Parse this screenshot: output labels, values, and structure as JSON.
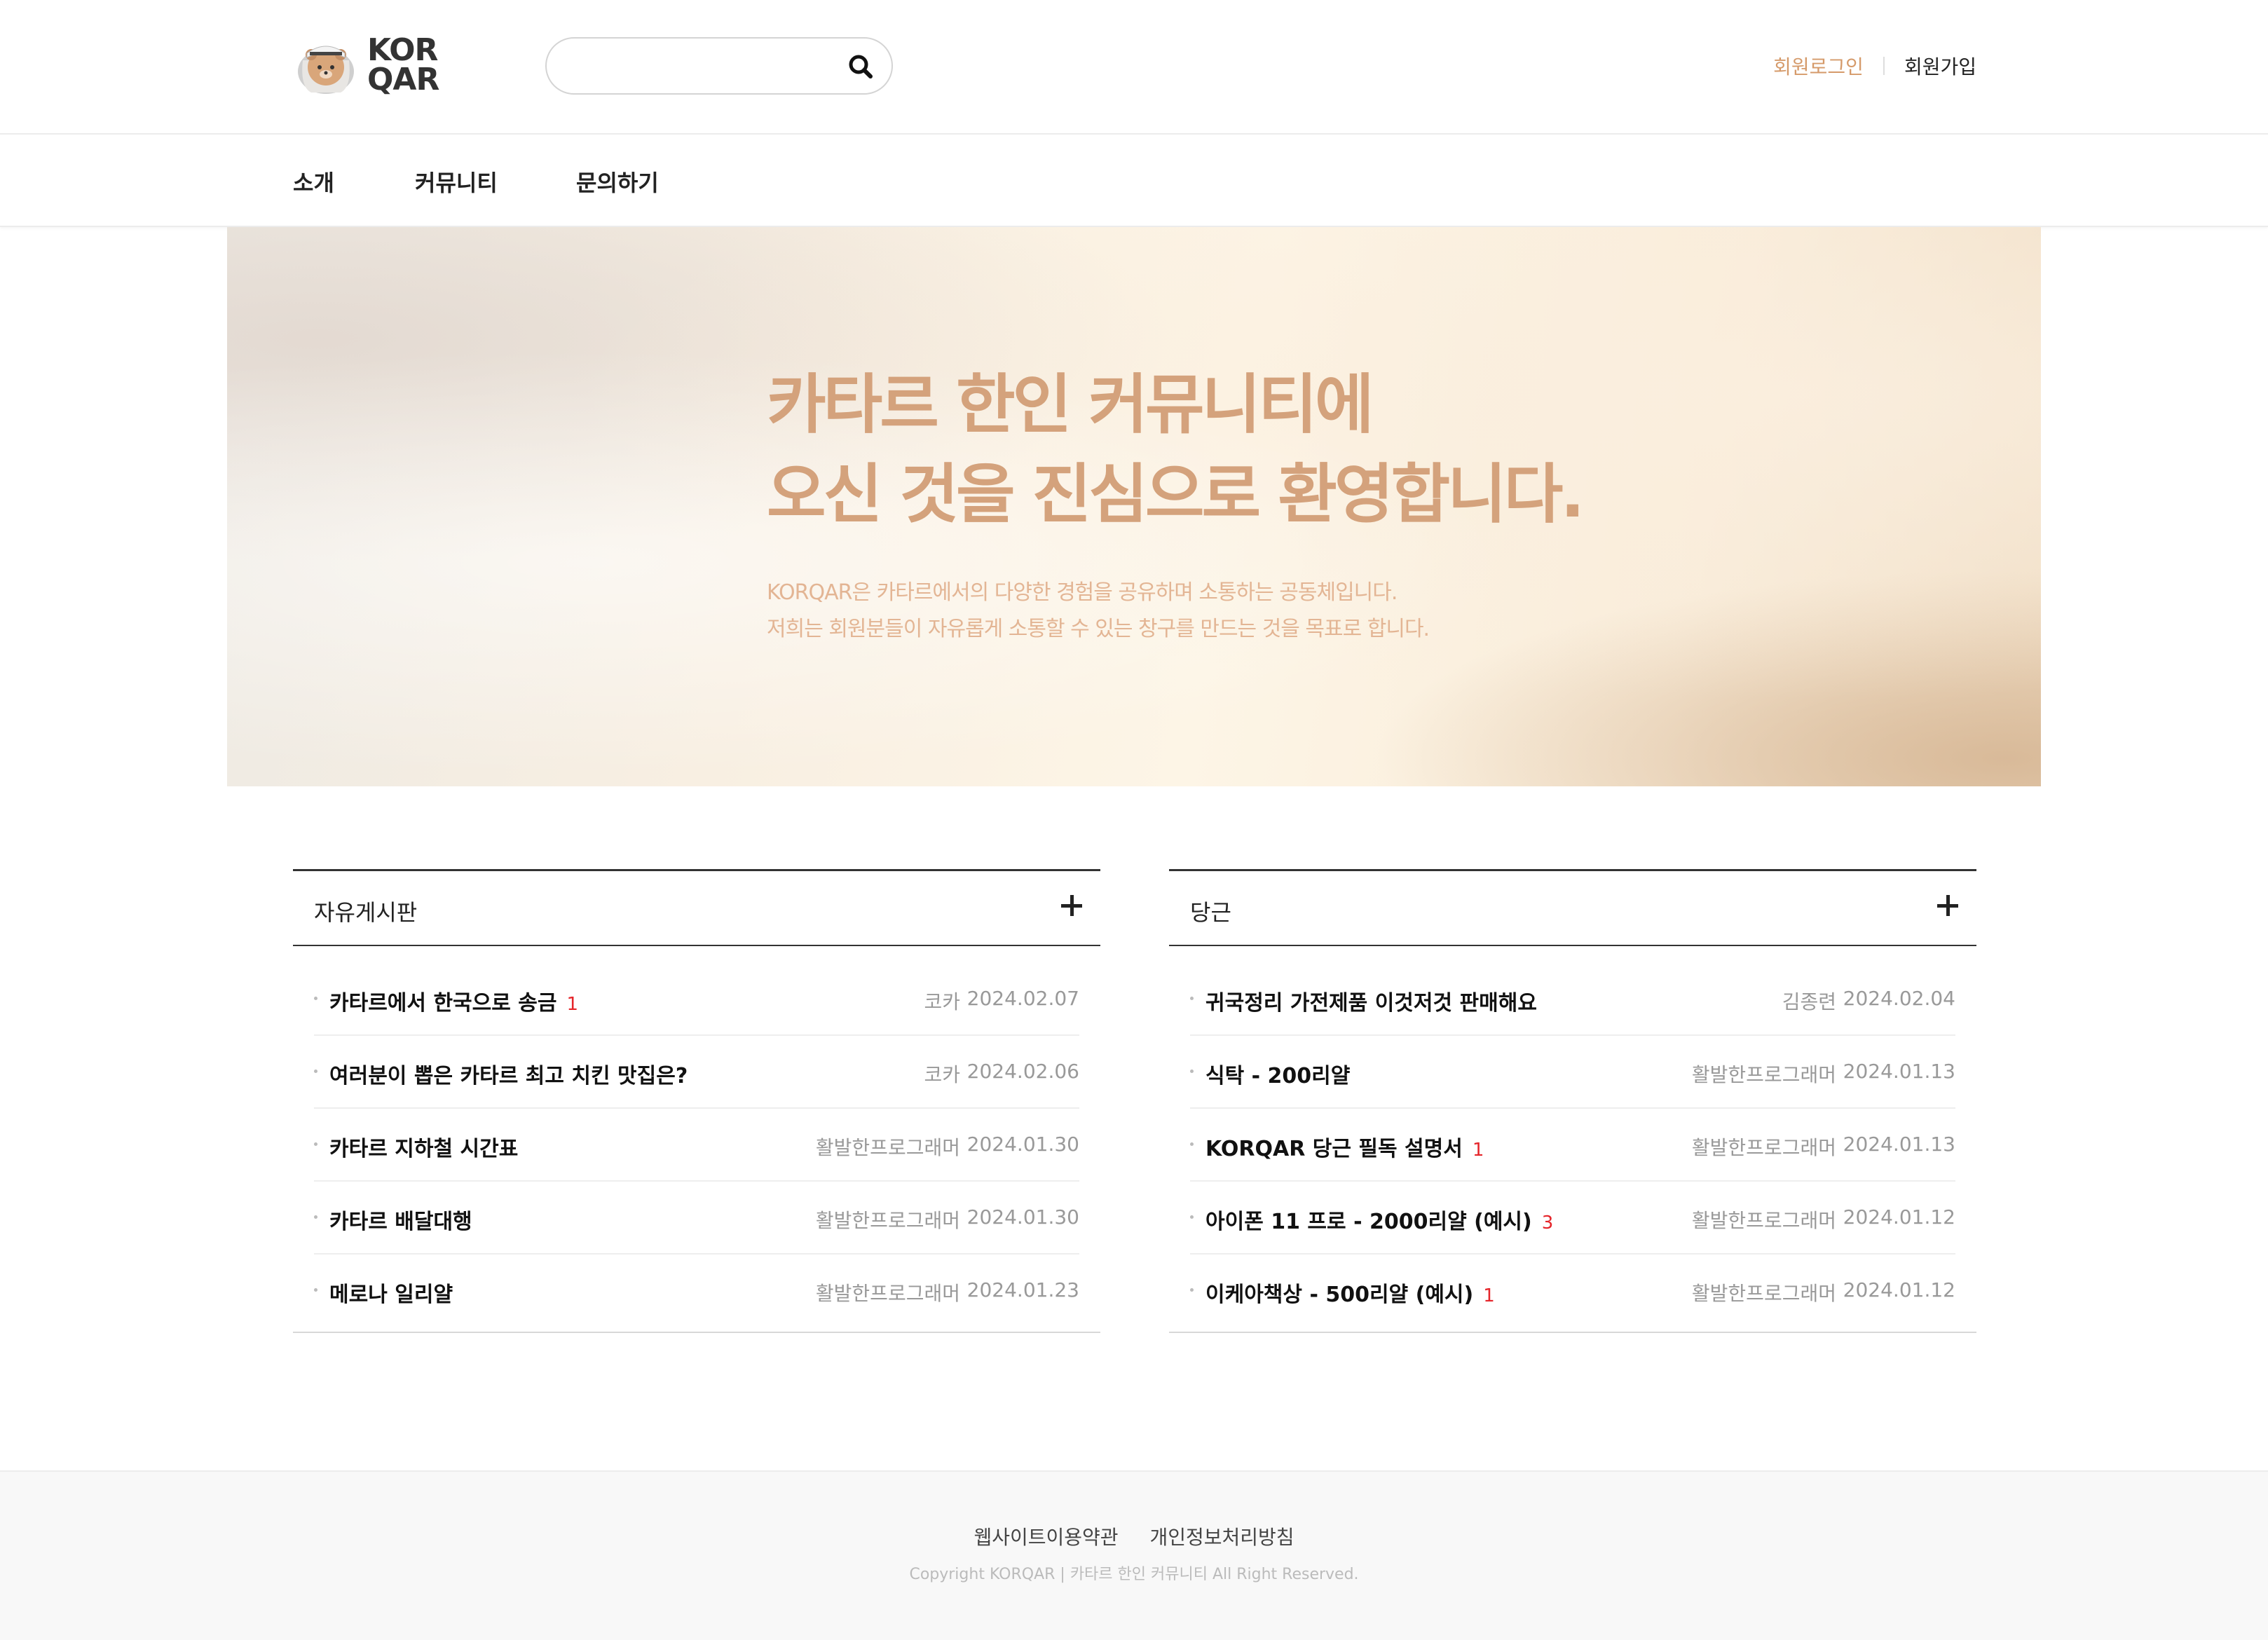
{
  "header": {
    "logo_text_line1": "KOR",
    "logo_text_line2": "QAR",
    "search_placeholder": "",
    "login_label": "회원로그인",
    "join_label": "회원가입"
  },
  "nav": [
    "소개",
    "커뮤니티",
    "문의하기"
  ],
  "hero": {
    "title_line1": "카타르 한인 커뮤니티에",
    "title_line2": "오신 것을 진심으로 환영합니다.",
    "desc_line1": "KORQAR은 카타르에서의 다양한 경험을 공유하며 소통하는 공동체입니다.",
    "desc_line2": "저희는 회원분들이 자유롭게 소통할 수 있는 창구를 만드는 것을 목표로 합니다."
  },
  "boards": [
    {
      "title": "자유게시판",
      "posts": [
        {
          "subject": "카타르에서 한국으로 송금",
          "comments": "1",
          "author": "코카",
          "date": "2024.02.07"
        },
        {
          "subject": "여러분이 뽑은 카타르 최고 치킨 맛집은?",
          "comments": "",
          "author": "코카",
          "date": "2024.02.06"
        },
        {
          "subject": "카타르 지하철 시간표",
          "comments": "",
          "author": "활발한프로그래머",
          "date": "2024.01.30"
        },
        {
          "subject": "카타르 배달대행",
          "comments": "",
          "author": "활발한프로그래머",
          "date": "2024.01.30"
        },
        {
          "subject": "메로나 일리얄",
          "comments": "",
          "author": "활발한프로그래머",
          "date": "2024.01.23"
        }
      ]
    },
    {
      "title": "당근",
      "posts": [
        {
          "subject": "귀국정리 가전제품 이것저것 판매해요",
          "comments": "",
          "author": "김종련",
          "date": "2024.02.04"
        },
        {
          "subject": "식탁 - 200리얄",
          "comments": "",
          "author": "활발한프로그래머",
          "date": "2024.01.13"
        },
        {
          "subject": "KORQAR 당근 필독 설명서",
          "comments": "1",
          "author": "활발한프로그래머",
          "date": "2024.01.13"
        },
        {
          "subject": "아이폰 11 프로 - 2000리얄 (예시)",
          "comments": "3",
          "author": "활발한프로그래머",
          "date": "2024.01.12"
        },
        {
          "subject": "이케아책상 - 500리얄 (예시)",
          "comments": "1",
          "author": "활발한프로그래머",
          "date": "2024.01.12"
        }
      ]
    }
  ],
  "footer": {
    "links": [
      "웹사이트이용약관",
      "개인정보처리방침"
    ],
    "copyright": "Copyright KORQAR | 카타르 한인 커뮤니티 All Right Reserved."
  },
  "colors": {
    "accent": "#d59a6a",
    "hero_title": "#d4a27c",
    "hero_desc": "#e3b594",
    "comment_count": "#e5252a"
  },
  "icons": [
    "bear-mascot-logo-icon",
    "search-icon",
    "plus-icon"
  ]
}
